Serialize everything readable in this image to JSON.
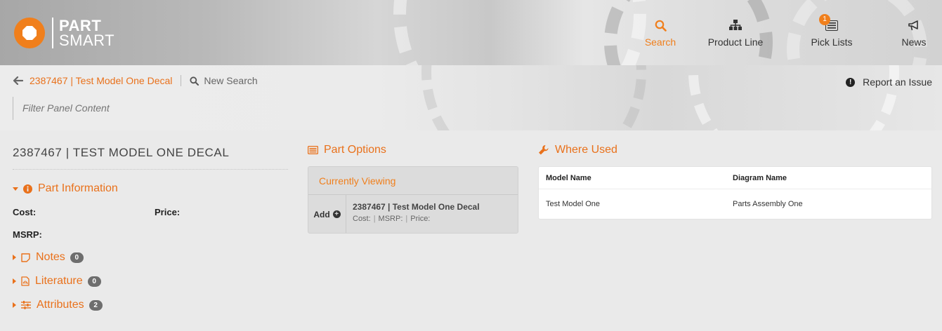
{
  "header": {
    "logo": {
      "line1": "PART",
      "line2": "SMART"
    },
    "nav": [
      {
        "label": "Search",
        "icon": "search-icon",
        "active": true
      },
      {
        "label": "Product Line",
        "icon": "sitemap-icon",
        "active": false
      },
      {
        "label": "Pick Lists",
        "icon": "list-icon",
        "active": false,
        "badge": "1"
      },
      {
        "label": "News",
        "icon": "megaphone-icon",
        "active": false
      }
    ]
  },
  "breadcrumb": {
    "back_label": "2387467 | Test Model One Decal",
    "new_search_label": "New Search",
    "report_label": "Report an Issue",
    "filter_placeholder": "Filter Panel Content"
  },
  "part": {
    "title": "2387467 | TEST MODEL ONE DECAL",
    "info_label": "Part Information",
    "cost_label": "Cost:",
    "price_label": "Price:",
    "msrp_label": "MSRP:",
    "sections": [
      {
        "label": "Notes",
        "count": "0",
        "icon": "note-icon"
      },
      {
        "label": "Literature",
        "count": "0",
        "icon": "pdf-icon"
      },
      {
        "label": "Attributes",
        "count": "2",
        "icon": "sliders-icon"
      }
    ]
  },
  "part_options": {
    "title": "Part Options",
    "currently_viewing": "Currently Viewing",
    "add_label": "Add",
    "item_name": "2387467 | Test Model One Decal",
    "cost_label": "Cost:",
    "msrp_label": "MSRP:",
    "price_label": "Price:"
  },
  "where_used": {
    "title": "Where Used",
    "columns": [
      "Model Name",
      "Diagram Name"
    ],
    "rows": [
      [
        "Test Model One",
        "Parts Assembly One"
      ]
    ]
  },
  "colors": {
    "accent": "#f07f1c",
    "link": "#e9711b",
    "badge_bg": "#6e6e6e"
  }
}
